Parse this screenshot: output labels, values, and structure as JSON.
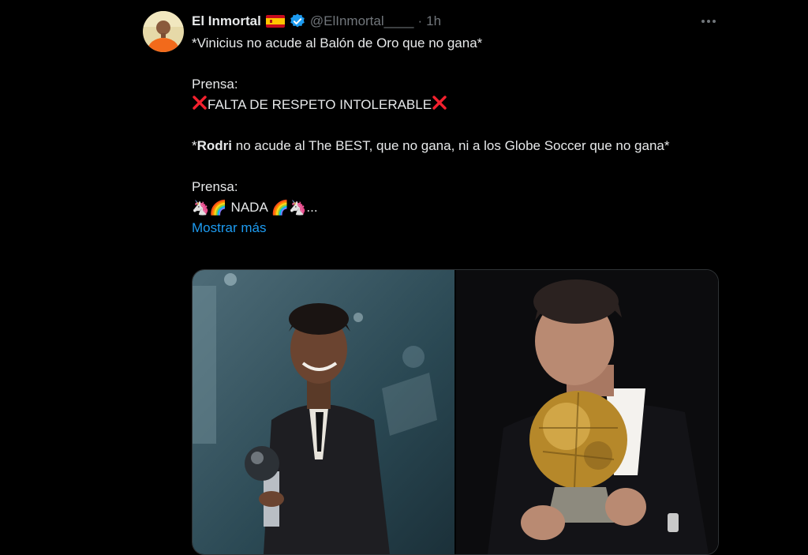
{
  "author": {
    "display_name": "El Inmortal",
    "flag_icon": "spain-flag-icon",
    "verified_icon": "verified-badge-icon",
    "handle": "@ElInmortal____",
    "separator": "·",
    "time": "1h"
  },
  "tweet": {
    "line1": "*Vinicius no acude al Balón de Oro que no gana*",
    "prensa1": "Prensa:",
    "line2": "FALTA DE RESPETO INTOLERABLE",
    "line3_bold": "Rodri",
    "line3_star": "*",
    "line3_rest": " no acude al The BEST, que no gana, ni a los Globe Soccer que no gana*",
    "prensa2": "Prensa:",
    "line4_emoji_left": "🦄🌈",
    "line4_text": " NADA ",
    "line4_emoji_right": "🌈🦄",
    "line4_ellipsis": "...",
    "show_more": "Mostrar más"
  },
  "colors": {
    "background": "#000000",
    "text": "#e7e9ea",
    "secondary": "#71767b",
    "link": "#1d9bf0",
    "verified": "#1d9bf0",
    "cross": "#f4212e"
  },
  "icons": {
    "more": "more-horizontal-icon",
    "cross": "cross-mark-icon"
  }
}
